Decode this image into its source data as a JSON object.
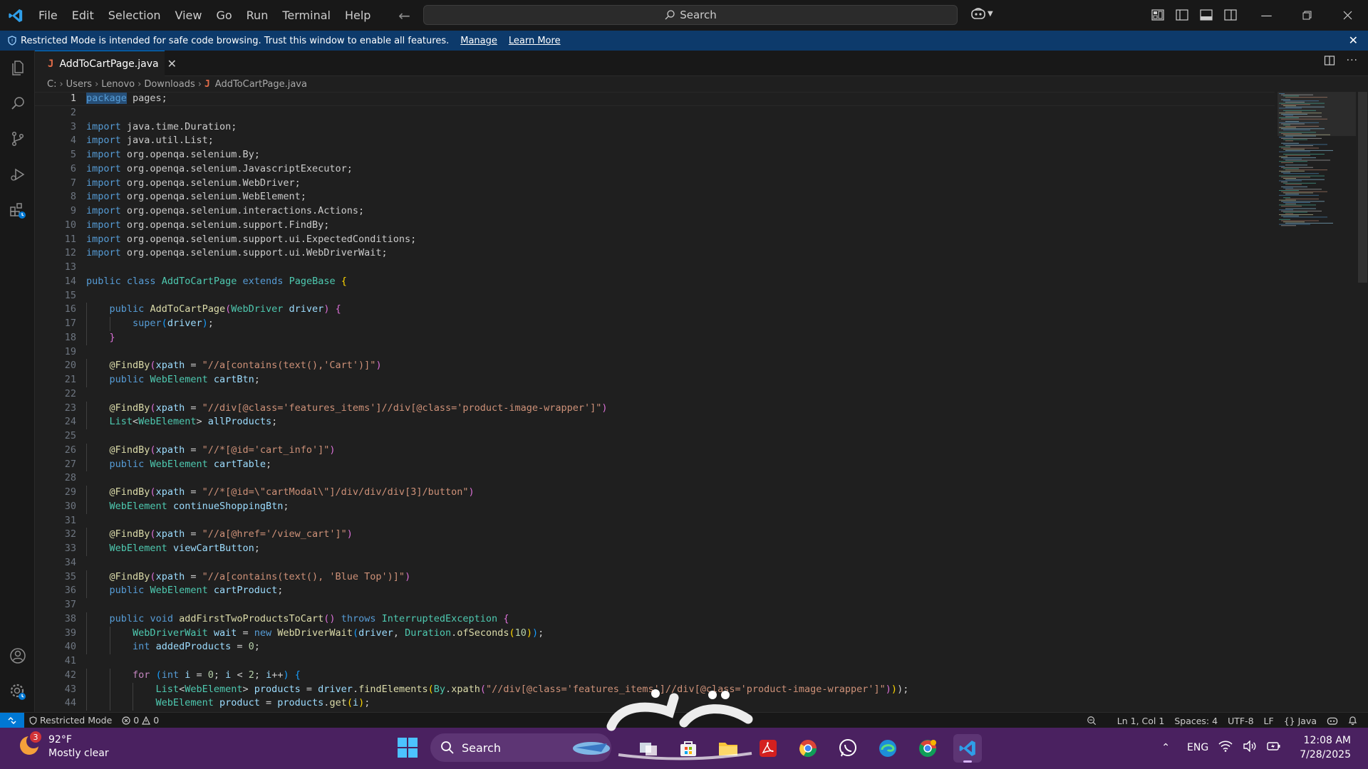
{
  "app": {
    "menu": [
      "File",
      "Edit",
      "Selection",
      "View",
      "Go",
      "Run",
      "Terminal",
      "Help"
    ],
    "search_label": "Search"
  },
  "banner": {
    "message": "Restricted Mode is intended for safe code browsing. Trust this window to enable all features.",
    "manage_label": "Manage",
    "learn_more_label": "Learn More"
  },
  "tab": {
    "filename": "AddToCartPage.java",
    "icon": "J"
  },
  "breadcrumb": [
    "C:",
    "Users",
    "Lenovo",
    "Downloads",
    "AddToCartPage.java"
  ],
  "editor": {
    "line_numbers": [
      "1",
      "2",
      "3",
      "4",
      "5",
      "6",
      "7",
      "8",
      "9",
      "10",
      "11",
      "12",
      "13",
      "14",
      "15",
      "16",
      "17",
      "18",
      "19",
      "20",
      "21",
      "22",
      "23",
      "24",
      "25",
      "26",
      "27",
      "28",
      "29",
      "30",
      "31",
      "32",
      "33",
      "34",
      "35",
      "36",
      "37",
      "38",
      "39",
      "40",
      "41",
      "42",
      "43",
      "44"
    ]
  },
  "status": {
    "mode": "Restricted Mode",
    "errors": "0",
    "warnings": "0",
    "position": "Ln 1, Col 1",
    "spaces": "Spaces: 4",
    "encoding": "UTF-8",
    "eol": "LF",
    "language": "Java"
  },
  "taskbar": {
    "weather_temp": "92°F",
    "weather_desc": "Mostly clear",
    "weather_badge": "3",
    "search_label": "Search",
    "language": "ENG",
    "time": "12:08 AM",
    "date": "7/28/2025"
  },
  "colors": {
    "accent": "#0078d4",
    "banner": "#0d3a6b",
    "taskbar": "#4a2160"
  }
}
